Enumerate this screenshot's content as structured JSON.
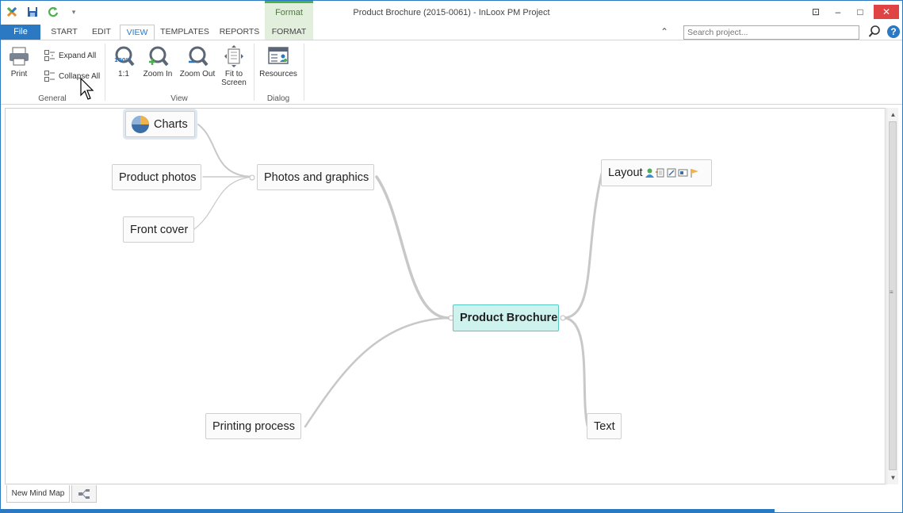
{
  "window": {
    "title": "Product Brochure (2015-0061) - InLoox PM Project",
    "context_tab_header": "Format",
    "controls": {
      "restore_glyph": "⊡",
      "minimize_glyph": "–",
      "maximize_glyph": "□",
      "close_glyph": "✕"
    }
  },
  "qat": {
    "dropdown_glyph": "▾"
  },
  "tabs": {
    "file": "File",
    "items": [
      "START",
      "EDIT",
      "VIEW",
      "TEMPLATES",
      "REPORTS",
      "FORMAT"
    ],
    "active": "VIEW"
  },
  "search": {
    "placeholder": "Search project...",
    "collapse_glyph": "⌃",
    "help_glyph": "?"
  },
  "ribbon": {
    "general": {
      "label": "General",
      "print": "Print",
      "expand_all": "Expand All",
      "collapse_all": "Collapse All"
    },
    "view": {
      "label": "View",
      "one_to_one": "1:1",
      "one_to_one_badge": "100%",
      "zoom_in": "Zoom In",
      "zoom_out": "Zoom Out",
      "fit_to_screen": "Fit to Screen"
    },
    "dialog": {
      "label": "Dialog",
      "resources": "Resources"
    }
  },
  "mindmap": {
    "root": "Product Brochure",
    "nodes": {
      "charts": "Charts",
      "photos_and_graphics": "Photos and graphics",
      "product_photos": "Product photos",
      "front_cover": "Front cover",
      "printing_process": "Printing process",
      "layout": "Layout",
      "text": "Text"
    }
  },
  "scrollbar": {
    "up": "▲",
    "down": "▼",
    "grip": "≡"
  },
  "bottom": {
    "mindmap_tab": "New Mind Map"
  },
  "colors": {
    "accent": "#2b79c2",
    "root_fill": "#cef3ef",
    "root_border": "#58c9c0",
    "format_tab": "#e2efdc",
    "close_button": "#e04343"
  }
}
